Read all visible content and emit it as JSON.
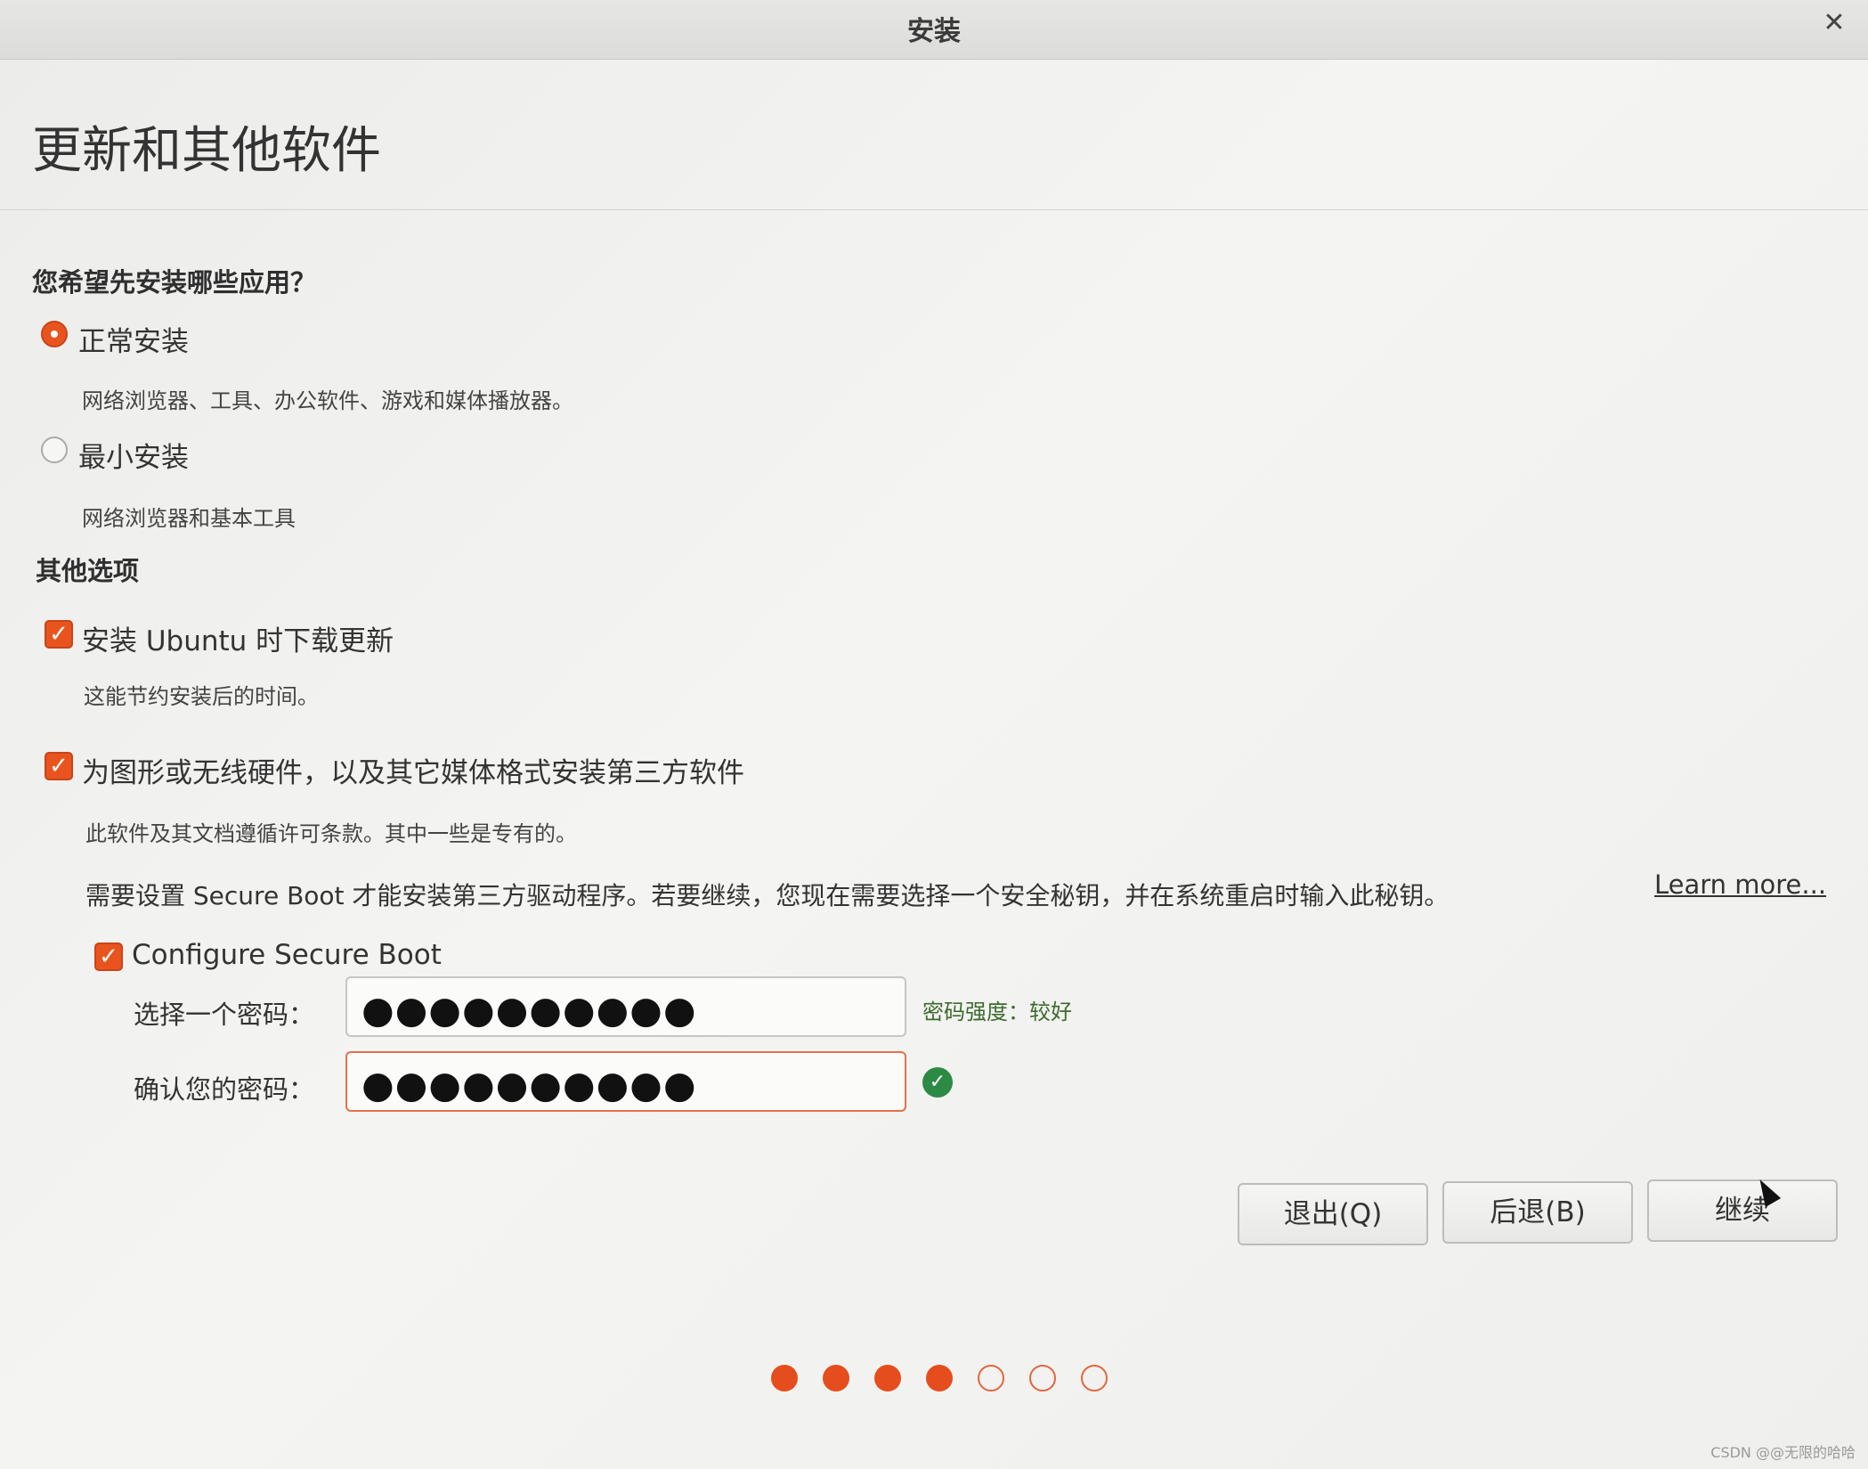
{
  "window": {
    "title": "安装",
    "close_glyph": "✕"
  },
  "page": {
    "title": "更新和其他软件"
  },
  "install_type": {
    "question": "您希望先安装哪些应用？",
    "options": [
      {
        "label": "正常安装",
        "description": "网络浏览器、工具、办公软件、游戏和媒体播放器。",
        "selected": true
      },
      {
        "label": "最小安装",
        "description": "网络浏览器和基本工具",
        "selected": false
      }
    ]
  },
  "other_options": {
    "heading": "其他选项",
    "download_updates": {
      "label": "安装 Ubuntu 时下载更新",
      "description": "这能节约安装后的时间。",
      "checked": true
    },
    "third_party": {
      "label": "为图形或无线硬件，以及其它媒体格式安装第三方软件",
      "description": "此软件及其文档遵循许可条款。其中一些是专有的。",
      "checked": true
    },
    "secure_boot_note": "需要设置 Secure Boot 才能安装第三方驱动程序。若要继续，您现在需要选择一个安全秘钥，并在系统重启时输入此秘钥。",
    "learn_more": "Learn more...",
    "configure_secure_boot": {
      "label": "Configure Secure Boot",
      "checked": true
    },
    "password": {
      "label": "选择一个密码：",
      "value": "●●●●●●●●●●",
      "strength": "密码强度：较好"
    },
    "confirm_password": {
      "label": "确认您的密码：",
      "value": "●●●●●●●●●●",
      "match_icon": "check-circle-icon"
    }
  },
  "buttons": {
    "quit": "退出(Q)",
    "back": "后退(B)",
    "continue": "继续"
  },
  "progress": {
    "total_steps": 7,
    "completed_steps": 4
  },
  "watermark": "CSDN @@无限的哈哈",
  "colors": {
    "accent": "#e9541e",
    "success": "#2c8a45"
  }
}
